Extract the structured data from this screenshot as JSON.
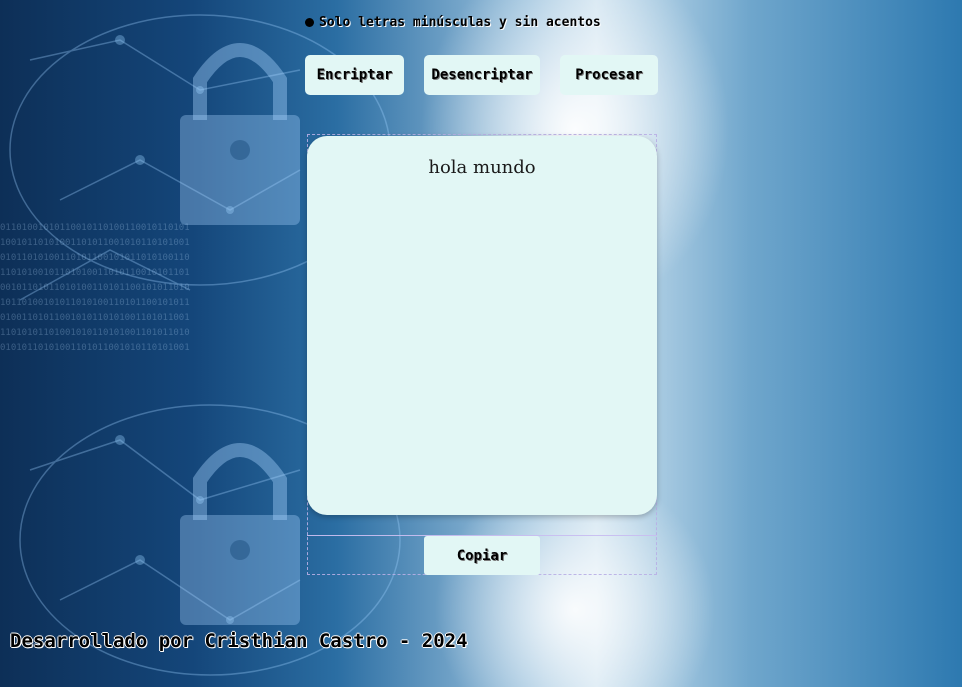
{
  "instructions": {
    "note": "Solo letras minúsculas y sin acentos"
  },
  "actions": {
    "encrypt_label": "Encriptar",
    "decrypt_label": "Desencriptar",
    "process_label": "Procesar"
  },
  "output": {
    "text": "hola mundo"
  },
  "copy": {
    "label": "Copiar"
  },
  "footer": {
    "credit": "Desarrollado por Cristhian Castro - 2024"
  },
  "colors": {
    "button_bg": "#e2f7f5",
    "textarea_bg": "#e2f7f5",
    "background_dark": "#0d2f57",
    "background_light": "#cfe3f0"
  }
}
